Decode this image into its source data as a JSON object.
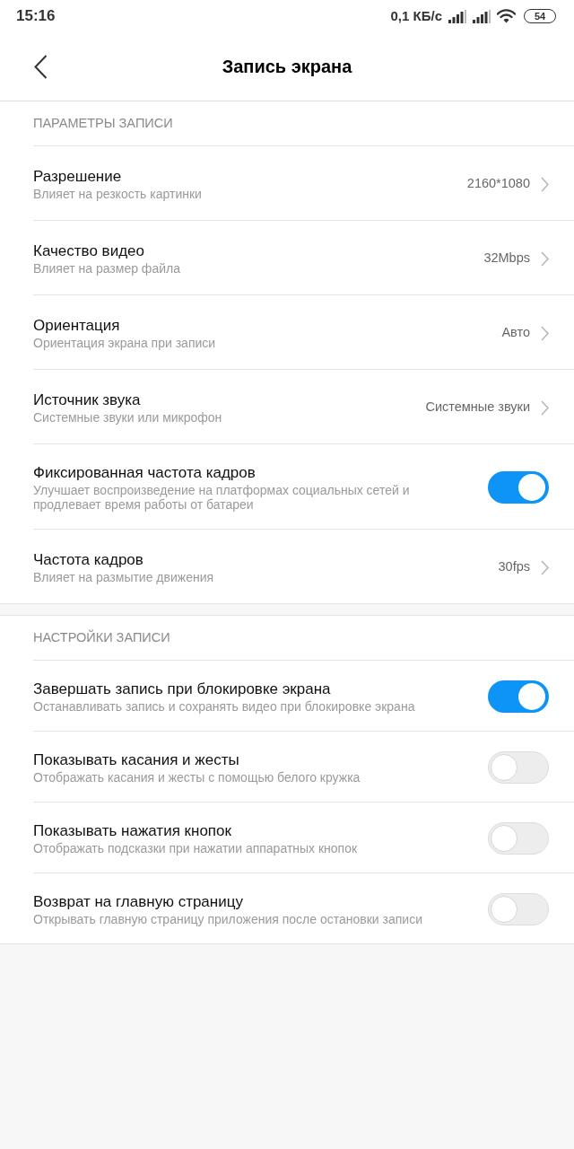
{
  "status_bar": {
    "time": "15:16",
    "network_speed": "0,1 КБ/с",
    "battery": "54"
  },
  "header": {
    "title": "Запись экрана"
  },
  "sections": [
    {
      "title": "ПАРАМЕТРЫ ЗАПИСИ",
      "items": [
        {
          "kind": "value",
          "title": "Разрешение",
          "subtitle": "Влияет на резкость картинки",
          "value": "2160*1080"
        },
        {
          "kind": "value",
          "title": "Качество видео",
          "subtitle": "Влияет на размер файла",
          "value": "32Mbps"
        },
        {
          "kind": "value",
          "title": "Ориентация",
          "subtitle": "Ориентация экрана при записи",
          "value": "Авто"
        },
        {
          "kind": "value",
          "title": "Источник звука",
          "subtitle": "Системные звуки или микрофон",
          "value": "Системные звуки"
        },
        {
          "kind": "toggle",
          "title": "Фиксированная частота кадров",
          "subtitle": "Улучшает воспроизведение на платформах социальных сетей и продлевает время работы от батареи",
          "on": true
        },
        {
          "kind": "value",
          "title": "Частота кадров",
          "subtitle": "Влияет на размытие движения",
          "value": "30fps"
        }
      ]
    },
    {
      "title": "НАСТРОЙКИ ЗАПИСИ",
      "items": [
        {
          "kind": "toggle",
          "title": "Завершать запись при блокировке экрана",
          "subtitle": "Останавливать запись и сохранять видео при блокировке экрана",
          "on": true
        },
        {
          "kind": "toggle",
          "title": "Показывать касания и жесты",
          "subtitle": "Отображать касания и жесты с помощью белого кружка",
          "on": false
        },
        {
          "kind": "toggle",
          "title": "Показывать нажатия кнопок",
          "subtitle": "Отображать подсказки при нажатии аппаратных кнопок",
          "on": false
        },
        {
          "kind": "toggle",
          "title": "Возврат на главную страницу",
          "subtitle": "Открывать главную страницу приложения после остановки записи",
          "on": false
        }
      ]
    }
  ]
}
